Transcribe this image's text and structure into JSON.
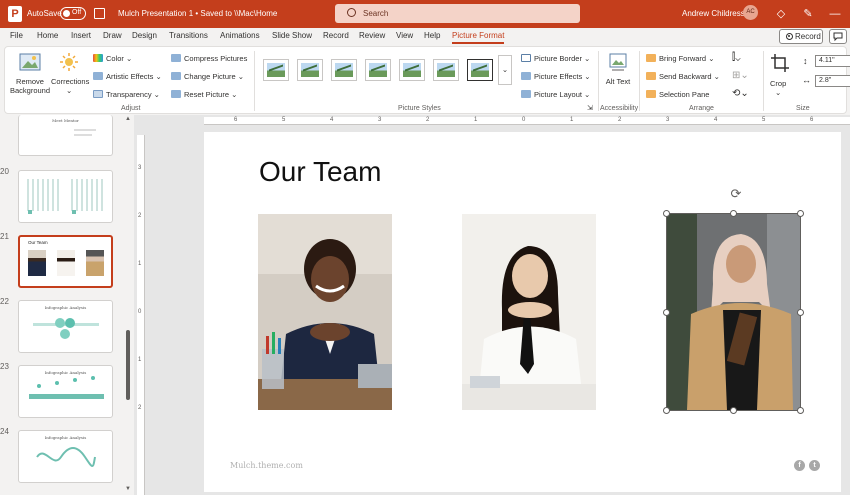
{
  "titlebar": {
    "logo": "P",
    "autosave_label": "AutoSave",
    "autosave_state": "Off",
    "doc_title": "Mulch Presentation 1 • Saved to \\\\Mac\\Home",
    "search_placeholder": "Search",
    "user_name": "Andrew Childress",
    "user_initials": "AC",
    "icons": [
      "diamond-icon",
      "pen-icon",
      "minimize-icon"
    ]
  },
  "tabs": [
    "File",
    "Home",
    "Insert",
    "Draw",
    "Design",
    "Transitions",
    "Animations",
    "Slide Show",
    "Record",
    "Review",
    "View",
    "Help",
    "Picture Format"
  ],
  "active_tab": "Picture Format",
  "record_label": "Record",
  "ribbon": {
    "adjust": {
      "remove_background": "Remove Background",
      "corrections": "Corrections",
      "color": "Color",
      "artistic_effects": "Artistic Effects",
      "transparency": "Transparency",
      "compress_pictures": "Compress Pictures",
      "change_picture": "Change Picture",
      "reset_picture": "Reset Picture",
      "group_label": "Adjust"
    },
    "picture_styles": {
      "group_label": "Picture Styles",
      "picture_border": "Picture Border",
      "picture_effects": "Picture Effects",
      "picture_layout": "Picture Layout"
    },
    "accessibility": {
      "alt_text": "Alt Text",
      "group_label": "Accessibility"
    },
    "arrange": {
      "bring_forward": "Bring Forward",
      "send_backward": "Send Backward",
      "selection_pane": "Selection Pane",
      "group_label": "Arrange"
    },
    "size": {
      "crop": "Crop",
      "height": "4.11\"",
      "width": "2.8\"",
      "group_label": "Size"
    }
  },
  "slides": [
    {
      "num": "",
      "title": "Meet Mentor"
    },
    {
      "num": "20",
      "title": ""
    },
    {
      "num": "21",
      "title": "Our Team"
    },
    {
      "num": "22",
      "title": "Infographic Analysis"
    },
    {
      "num": "23",
      "title": "Infographic Analysis"
    },
    {
      "num": "24",
      "title": "Infographic Analysis"
    }
  ],
  "slide": {
    "title": "Our Team",
    "footer": "Mulch.theme.com",
    "social": [
      "f",
      "t"
    ]
  },
  "ruler": {
    "h_ticks": [
      "6",
      "5",
      "4",
      "3",
      "2",
      "1",
      "0",
      "1",
      "2",
      "3",
      "4",
      "5",
      "6"
    ],
    "v_ticks": [
      "3",
      "2",
      "1",
      "0",
      "1",
      "2"
    ]
  }
}
